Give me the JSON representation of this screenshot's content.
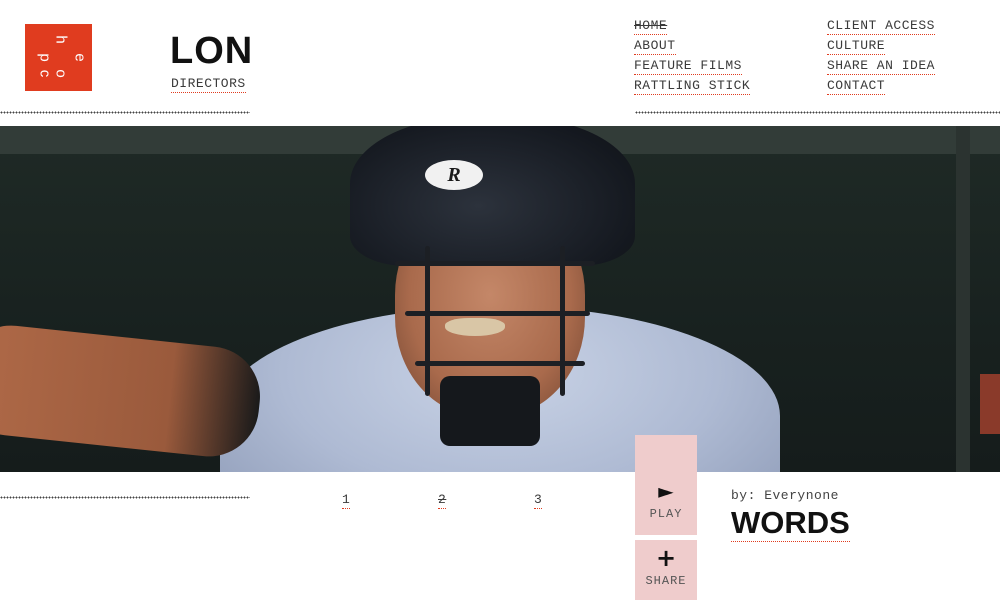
{
  "logo": {
    "letters": [
      "p",
      "e",
      "c",
      "h",
      "o"
    ],
    "name": "logo-mark"
  },
  "office": {
    "title": "LON",
    "directors_label": "DIRECTORS"
  },
  "nav": {
    "primary": [
      "HOME",
      "ABOUT",
      "FEATURE FILMS",
      "RATTLING STICK"
    ],
    "secondary": [
      "CLIENT ACCESS",
      "CULTURE",
      "SHARE AN IDEA",
      "CONTACT"
    ],
    "active": "HOME"
  },
  "hero": {
    "helmet_brand": "R"
  },
  "pager": [
    "1",
    "2",
    "3"
  ],
  "controls": {
    "play_label": "PLAY",
    "share_label": "SHARE",
    "play_glyph": "►",
    "share_glyph": "+"
  },
  "feature": {
    "byline": "by: Everynone",
    "title": "WORDS"
  },
  "colors": {
    "accent": "#e03c1f",
    "tile": "#efcccc",
    "text": "#3a3a3a"
  }
}
